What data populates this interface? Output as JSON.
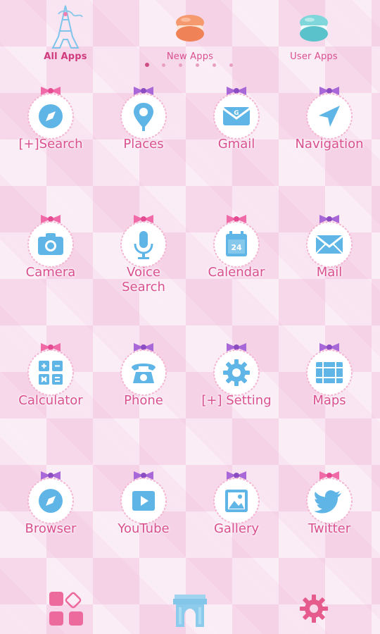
{
  "top_tabs": [
    {
      "label": "All Apps",
      "icon": "eiffel-tower-icon",
      "active": true
    },
    {
      "label": "New Apps",
      "icon": "macaron-orange-icon",
      "active": false
    },
    {
      "label": "User Apps",
      "icon": "macaron-teal-icon",
      "active": false
    }
  ],
  "page_dots": {
    "count": 6,
    "active_index": 0
  },
  "apps": [
    {
      "label": "[+]Search",
      "icon": "compass-icon",
      "bow": "pink"
    },
    {
      "label": "Places",
      "icon": "map-pin-icon",
      "bow": "purple"
    },
    {
      "label": "Gmail",
      "icon": "gmail-envelope-icon",
      "bow": "purple"
    },
    {
      "label": "Navigation",
      "icon": "navigation-arrow-icon",
      "bow": "purple"
    },
    {
      "label": "Camera",
      "icon": "camera-icon",
      "bow": "pink"
    },
    {
      "label": "Voice\nSearch",
      "icon": "microphone-icon",
      "bow": "pink"
    },
    {
      "label": "Calendar",
      "icon": "calendar-icon",
      "bow": "pink",
      "calendar_day": "24"
    },
    {
      "label": "Mail",
      "icon": "mail-envelope-icon",
      "bow": "purple"
    },
    {
      "label": "Calculator",
      "icon": "calculator-icon",
      "bow": "pink"
    },
    {
      "label": "Phone",
      "icon": "phone-icon",
      "bow": "purple"
    },
    {
      "label": "[+] Setting",
      "icon": "gear-icon",
      "bow": "purple"
    },
    {
      "label": "Maps",
      "icon": "map-icon",
      "bow": "purple"
    },
    {
      "label": "Browser",
      "icon": "compass-icon",
      "bow": "purple"
    },
    {
      "label": "YouTube",
      "icon": "play-icon",
      "bow": "purple"
    },
    {
      "label": "Gallery",
      "icon": "gallery-icon",
      "bow": "purple"
    },
    {
      "label": "Twitter",
      "icon": "twitter-bird-icon",
      "bow": "pink"
    }
  ],
  "dock": [
    {
      "icon": "apps-grid-icon"
    },
    {
      "icon": "arc-de-triomphe-icon"
    },
    {
      "icon": "gear-icon"
    }
  ],
  "colors": {
    "label_pink": "#d9508f",
    "icon_blue": "#5eb5e6",
    "bow_pink": "#f06aa8",
    "bow_purple": "#a868d8",
    "badge_border": "#f4b6d2"
  }
}
